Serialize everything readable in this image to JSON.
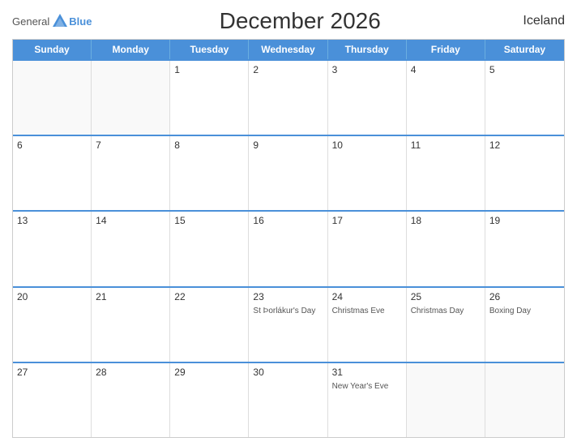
{
  "header": {
    "logo_general": "General",
    "logo_blue": "Blue",
    "title": "December 2026",
    "country": "Iceland"
  },
  "days_of_week": [
    "Sunday",
    "Monday",
    "Tuesday",
    "Wednesday",
    "Thursday",
    "Friday",
    "Saturday"
  ],
  "weeks": [
    [
      {
        "day": "",
        "holiday": ""
      },
      {
        "day": "",
        "holiday": ""
      },
      {
        "day": "1",
        "holiday": ""
      },
      {
        "day": "2",
        "holiday": ""
      },
      {
        "day": "3",
        "holiday": ""
      },
      {
        "day": "4",
        "holiday": ""
      },
      {
        "day": "5",
        "holiday": ""
      }
    ],
    [
      {
        "day": "6",
        "holiday": ""
      },
      {
        "day": "7",
        "holiday": ""
      },
      {
        "day": "8",
        "holiday": ""
      },
      {
        "day": "9",
        "holiday": ""
      },
      {
        "day": "10",
        "holiday": ""
      },
      {
        "day": "11",
        "holiday": ""
      },
      {
        "day": "12",
        "holiday": ""
      }
    ],
    [
      {
        "day": "13",
        "holiday": ""
      },
      {
        "day": "14",
        "holiday": ""
      },
      {
        "day": "15",
        "holiday": ""
      },
      {
        "day": "16",
        "holiday": ""
      },
      {
        "day": "17",
        "holiday": ""
      },
      {
        "day": "18",
        "holiday": ""
      },
      {
        "day": "19",
        "holiday": ""
      }
    ],
    [
      {
        "day": "20",
        "holiday": ""
      },
      {
        "day": "21",
        "holiday": ""
      },
      {
        "day": "22",
        "holiday": ""
      },
      {
        "day": "23",
        "holiday": "St Þorlákur's Day"
      },
      {
        "day": "24",
        "holiday": "Christmas Eve"
      },
      {
        "day": "25",
        "holiday": "Christmas Day"
      },
      {
        "day": "26",
        "holiday": "Boxing Day"
      }
    ],
    [
      {
        "day": "27",
        "holiday": ""
      },
      {
        "day": "28",
        "holiday": ""
      },
      {
        "day": "29",
        "holiday": ""
      },
      {
        "day": "30",
        "holiday": ""
      },
      {
        "day": "31",
        "holiday": "New Year's Eve"
      },
      {
        "day": "",
        "holiday": ""
      },
      {
        "day": "",
        "holiday": ""
      }
    ]
  ]
}
